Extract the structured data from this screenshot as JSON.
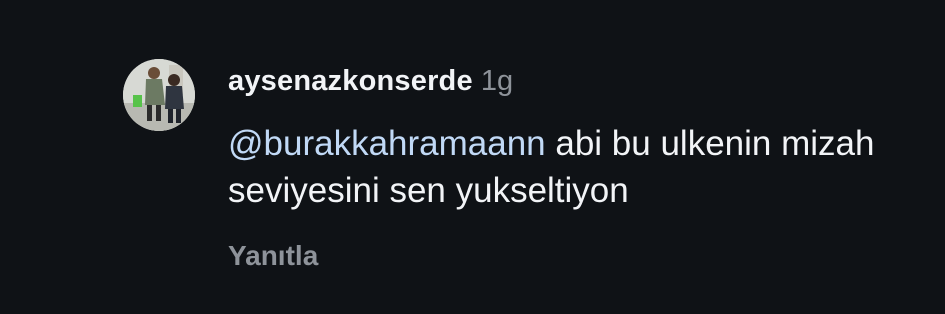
{
  "comment": {
    "username": "aysenazkonserde",
    "timestamp": "1g",
    "mention": "@burakkahramaann",
    "body": " abi bu ulkenin mizah seviyesini sen yukseltiyon",
    "reply_label": "Yanıtla",
    "avatar_icon": "profile-photo-icon"
  },
  "colors": {
    "background": "#0f1216",
    "text": "#f2f4f7",
    "muted": "#8e939a",
    "mention": "#c1d9f6"
  }
}
